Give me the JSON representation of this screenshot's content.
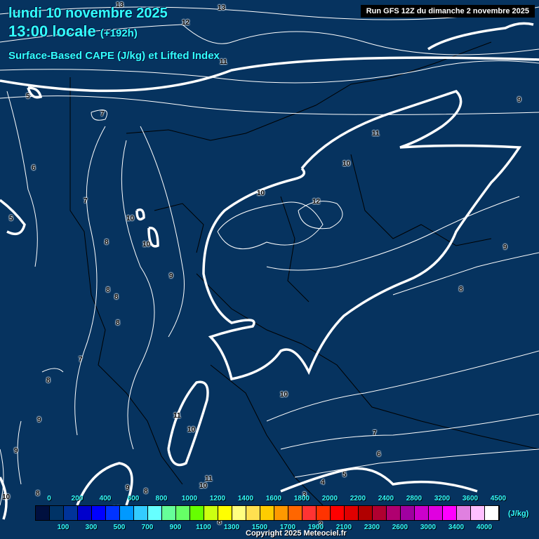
{
  "header": {
    "date": "lundi 10 novembre 2025",
    "time": "13:00 locale",
    "lead": "(+192h)",
    "parameter": "Surface-Based CAPE (J/kg) et Lifted Index",
    "run": "Run GFS 12Z du dimanche 2 novembre 2025"
  },
  "contour_labels": [
    "13",
    "13",
    "12",
    "11",
    "5",
    "7",
    "6",
    "5",
    "7",
    "10",
    "10",
    "8",
    "9",
    "8",
    "8",
    "8",
    "7",
    "8",
    "9",
    "9",
    "10",
    "10",
    "12",
    "11",
    "10",
    "9",
    "8",
    "9",
    "10",
    "11",
    "10",
    "11",
    "10",
    "8",
    "9",
    "8",
    "7",
    "6",
    "5",
    "4",
    "3",
    "2",
    "8",
    "10"
  ],
  "colorbar": {
    "unit": "(J/kg)",
    "levels": [
      "0",
      "100",
      "200",
      "300",
      "400",
      "500",
      "600",
      "700",
      "800",
      "900",
      "1000",
      "1100",
      "1200",
      "1300",
      "1400",
      "1500",
      "1600",
      "1700",
      "1800",
      "1900",
      "2000",
      "2100",
      "2200",
      "2300",
      "2400",
      "2600",
      "2800",
      "3000",
      "3200",
      "3400",
      "3600",
      "4000",
      "4500"
    ],
    "colors": [
      "#00103f",
      "#003366",
      "#003399",
      "#0000cc",
      "#0000ff",
      "#0033ff",
      "#0099ff",
      "#33ccff",
      "#66ffff",
      "#66ff99",
      "#66ff66",
      "#66ff00",
      "#ccff11",
      "#ffff00",
      "#ffff80",
      "#ffe050",
      "#ffcc00",
      "#ff9900",
      "#ff6600",
      "#ff3333",
      "#ff3300",
      "#ff0000",
      "#e00000",
      "#b00000",
      "#b00030",
      "#b00070",
      "#a000a0",
      "#cc00cc",
      "#e000e0",
      "#ff00ff",
      "#e080e0",
      "#ffc0ff",
      "#ffffff"
    ]
  },
  "copyright": "Copyright 2025 Meteociel.fr"
}
